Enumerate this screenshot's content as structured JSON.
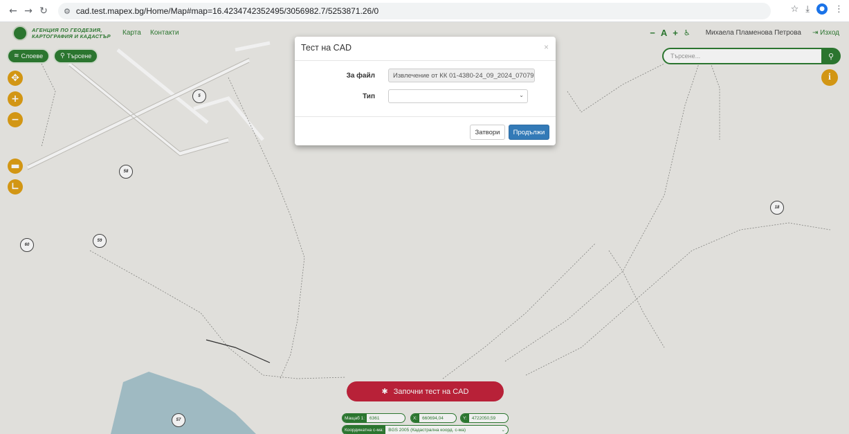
{
  "browser": {
    "back_icon": "arrow-left-icon",
    "url": "cad.test.mapex.bg/Home/Map#map=16.4234742352495/3056982.7/5253871.26/0"
  },
  "header": {
    "logo_line1": "АГЕНЦИЯ ПО ГЕОДЕЗИЯ,",
    "logo_line2": "КАРТОГРАФИЯ И КАДАСТЪР",
    "nav": [
      "Карта",
      "Контакти"
    ],
    "user": "Михаела Пламенова Петрова",
    "logout": "Изход",
    "tools": [
      "−",
      "A",
      "+",
      "♿"
    ]
  },
  "left_panel": {
    "layers_label": "Слоеве",
    "search_label": "Търсене"
  },
  "search": {
    "placeholder": "Търсене..."
  },
  "map": {
    "parcels": [
      "5",
      "58",
      "59",
      "60",
      "18",
      "57"
    ]
  },
  "modal": {
    "title": "Тест на CAD",
    "file_label": "За файл",
    "file_value": "Извлечение от КК 01-4380-24_09_2024_07079",
    "type_label": "Тип",
    "type_value": "",
    "close_button": "Затвори",
    "continue_button": "Продължи"
  },
  "bottom": {
    "start_button": "Започни тест на CAD",
    "scale_label": "Мащаб 1:",
    "scale_value": "6361",
    "x_label": "X:",
    "x_value": "660694,04",
    "y_label": "Y:",
    "y_value": "4722050,59",
    "crs_label": "Координатна с-ма:",
    "crs_value": "BGS 2005 (Кадастрална коорд. с-ма)"
  },
  "colors": {
    "green": "#2e7d32",
    "orange": "#e0a016",
    "red": "#c4243c",
    "blue": "#337ab7",
    "water": "#a9c6cf"
  }
}
